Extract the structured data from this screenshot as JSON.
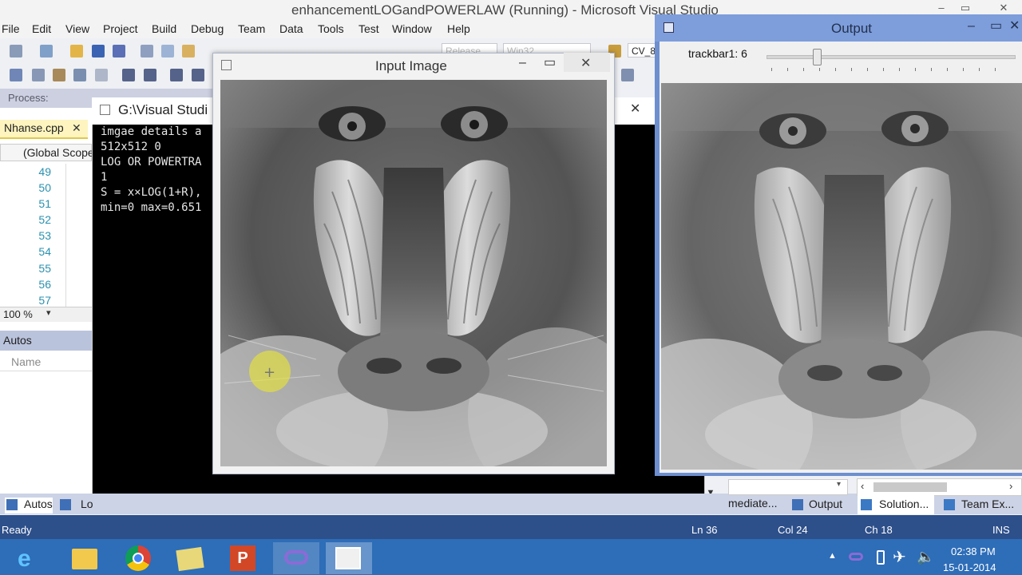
{
  "vs": {
    "title": "enhancementLOGandPOWERLAW (Running) - Microsoft Visual Studio",
    "menu": [
      "File",
      "Edit",
      "View",
      "Project",
      "Build",
      "Debug",
      "Team",
      "Data",
      "Tools",
      "Test",
      "Window",
      "Help"
    ],
    "config_combo": "Release",
    "platform_combo": "Win32",
    "cv_combo": "CV_8",
    "process_label": "Process:"
  },
  "editor": {
    "tab_label": "Nhanse.cpp",
    "scope_label": "(Global Scope",
    "line_numbers": [
      "49",
      "50",
      "51",
      "52",
      "53",
      "54",
      "55",
      "56",
      "57"
    ],
    "zoom": "100 %",
    "autos_label": "Autos",
    "name_column": "Name"
  },
  "console": {
    "title": "G:\\Visual Studi",
    "lines": [
      "imgae details a",
      "512x512 0",
      "LOG OR POWERTRA",
      "1",
      "S = x×LOG(1+R),",
      "min=0 max=0.651"
    ]
  },
  "input_window": {
    "title": "Input Image"
  },
  "output_window": {
    "title": "Output",
    "trackbar_label": "trackbar1: 6",
    "trackbar_value": 6
  },
  "bottom_tabs": {
    "autos": "Autos",
    "locals": "Lo",
    "immediate": "mediate...",
    "output": "Output",
    "solution": "Solution...",
    "team": "Team Ex..."
  },
  "status": {
    "ready": "Ready",
    "ln": "Ln 36",
    "col": "Col 24",
    "ch": "Ch 18",
    "ins": "INS"
  },
  "taskbar": {
    "time": "02:38 PM",
    "date": "15-01-2014",
    "apps": [
      "internet-explorer",
      "file-explorer",
      "chrome",
      "folder-pictures",
      "powerpoint",
      "visual-studio",
      "output-window"
    ]
  },
  "colors": {
    "status_bar": "#2d4f8a",
    "taskbar": "#2e6db8",
    "output_frame": "#7d9ddb"
  }
}
